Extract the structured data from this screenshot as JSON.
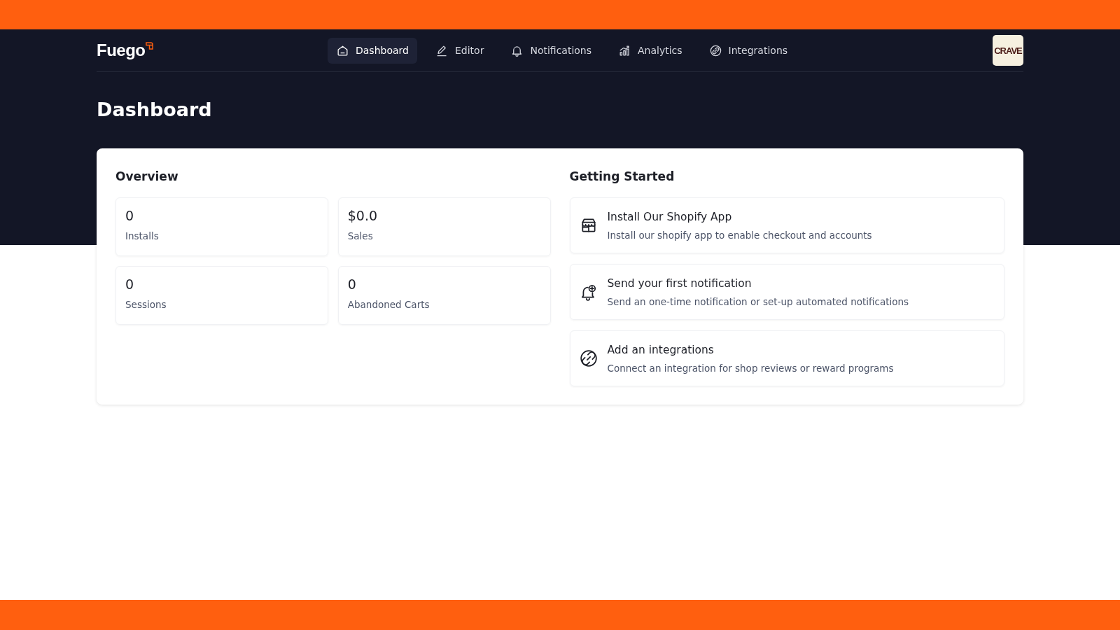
{
  "brand": {
    "logo": "Fuego"
  },
  "nav": [
    {
      "label": "Dashboard",
      "selected": true
    },
    {
      "label": "Editor",
      "selected": false
    },
    {
      "label": "Notifications",
      "selected": false
    },
    {
      "label": "Analytics",
      "selected": false
    },
    {
      "label": "Integrations",
      "selected": false
    }
  ],
  "account": {
    "logo": "CRAVE"
  },
  "page_title": "Dashboard",
  "overview": {
    "title": "Overview",
    "stats": [
      {
        "value": "0",
        "label": "Installs"
      },
      {
        "value": "$0.0",
        "label": "Sales"
      },
      {
        "value": "0",
        "label": "Sessions"
      },
      {
        "value": "0",
        "label": "Abandoned Carts"
      }
    ]
  },
  "getting_started": {
    "title": "Getting Started",
    "steps": [
      {
        "title": "Install Our Shopify App",
        "description": "Install our shopify app to enable checkout and accounts"
      },
      {
        "title": "Send your first notification",
        "description": "Send an one-time notification or set-up automated notifications"
      },
      {
        "title": "Add an integrations",
        "description": "Connect an integration for shop reviews or reward programs"
      }
    ]
  }
}
